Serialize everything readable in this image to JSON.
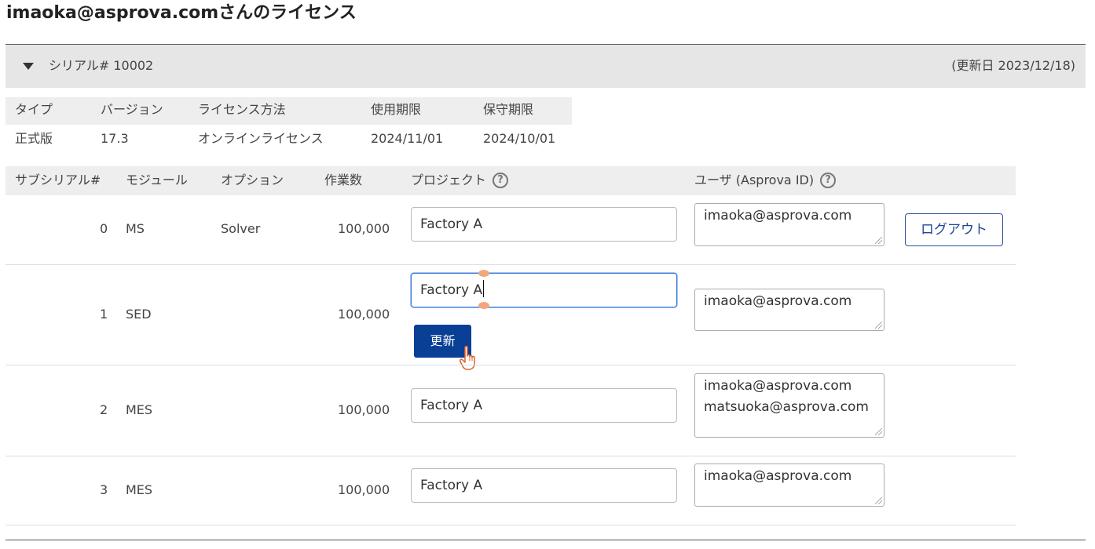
{
  "page": {
    "title": "imaoka@asprova.comさんのライセンス"
  },
  "serial": {
    "label": "シリアル# 10002",
    "updated": "(更新日 2023/12/18)"
  },
  "license": {
    "headers": [
      "タイプ",
      "バージョン",
      "ライセンス方法",
      "使用期限",
      "保守期限"
    ],
    "values": [
      "正式版",
      "17.3",
      "オンラインライセンス",
      "2024/11/01",
      "2024/10/01"
    ]
  },
  "subserials": {
    "headers": {
      "subserial": "サブシリアル#",
      "module": "モジュール",
      "option": "オプション",
      "count": "作業数",
      "project": "プロジェクト",
      "user": "ユーザ (Asprova ID)",
      "help": "?"
    },
    "rows": [
      {
        "no": "0",
        "module": "MS",
        "option": "Solver",
        "count": "100,000",
        "project": "Factory A",
        "users": "imaoka@asprova.com",
        "users2": ""
      },
      {
        "no": "1",
        "module": "SED",
        "option": "",
        "count": "100,000",
        "project": "Factory A",
        "users": "imaoka@asprova.com",
        "users2": ""
      },
      {
        "no": "2",
        "module": "MES",
        "option": "",
        "count": "100,000",
        "project": "Factory A",
        "users": "imaoka@asprova.com",
        "users2": "matsuoka@asprova.com"
      },
      {
        "no": "3",
        "module": "MES",
        "option": "",
        "count": "100,000",
        "project": "Factory A",
        "users": "imaoka@asprova.com",
        "users2": ""
      }
    ]
  },
  "buttons": {
    "logout": "ログアウト",
    "update": "更新"
  },
  "icons": {
    "expand": "caret-down-icon",
    "help": "help-circle-icon",
    "cursor": "hand-pointer-icon"
  },
  "colors": {
    "primary": "#0a3f96",
    "focus": "#3a7bd5",
    "header_bg": "#e6e6e6"
  }
}
